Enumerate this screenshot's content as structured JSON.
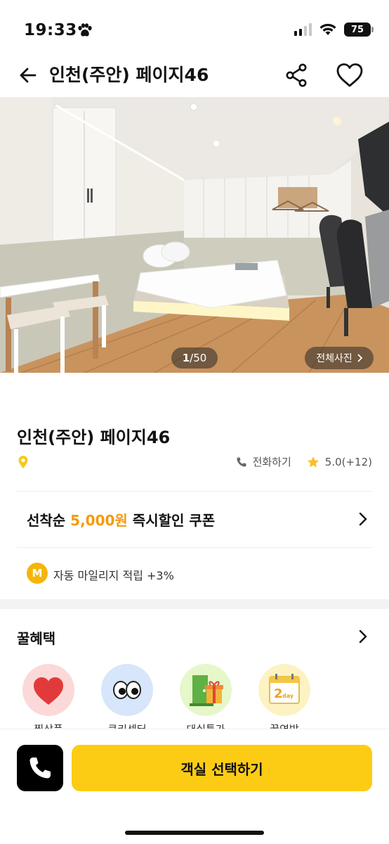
{
  "status_bar": {
    "time": "19:33",
    "battery": "75"
  },
  "header": {
    "title": "인천(주안) 페이지46"
  },
  "hero": {
    "counter_current": "1",
    "counter_total": "/50",
    "all_photos_label": "전체사진"
  },
  "info": {
    "name": "인천(주안) 페이지46",
    "call_label": "전화하기",
    "rating": "5.0(+12)"
  },
  "coupon": {
    "prefix": "선착순 ",
    "amount": "5,000원",
    "suffix": " 즉시할인 쿠폰"
  },
  "mileage": {
    "badge": "M",
    "text": "자동 마일리지 적립 +3%"
  },
  "benefits": {
    "title": "꿀혜택",
    "items": [
      {
        "icon": "heart-icon",
        "label": "찜상품",
        "bg": "#fbd9d9"
      },
      {
        "icon": "eyes-icon",
        "label": "쿠키센터",
        "bg": "#d7e6fa"
      },
      {
        "icon": "door-gift-icon",
        "label": "대실특가",
        "bg": "#e6f7c9"
      },
      {
        "icon": "calendar-2day-icon",
        "label": "꿀연박",
        "bg": "#fdf2c2"
      }
    ]
  },
  "bottom": {
    "select_room_label": "객실 선택하기"
  },
  "colors": {
    "accent": "#fccc15",
    "coupon_orange": "#f59a0c",
    "mileage_badge": "#f5b50a"
  }
}
